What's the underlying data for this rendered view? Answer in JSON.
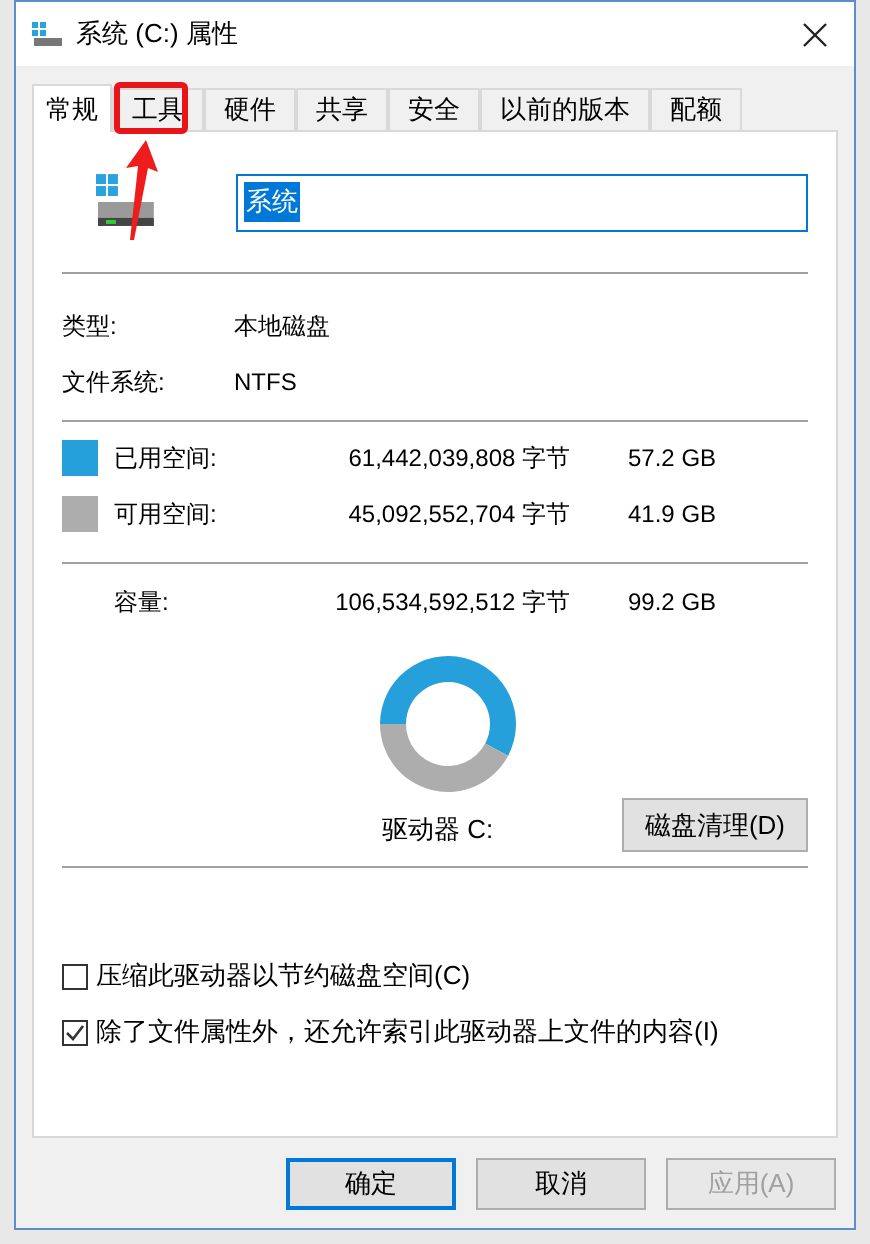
{
  "window": {
    "title": "系统 (C:) 属性"
  },
  "tabs": [
    {
      "label": "常规",
      "selected": true
    },
    {
      "label": "工具",
      "selected": false,
      "highlighted": true
    },
    {
      "label": "硬件",
      "selected": false
    },
    {
      "label": "共享",
      "selected": false
    },
    {
      "label": "安全",
      "selected": false
    },
    {
      "label": "以前的版本",
      "selected": false
    },
    {
      "label": "配额",
      "selected": false
    }
  ],
  "name_field": {
    "value": "系统"
  },
  "info": [
    {
      "label": "类型:",
      "value": "本地磁盘"
    },
    {
      "label": "文件系统:",
      "value": "NTFS"
    }
  ],
  "space": [
    {
      "label": "已用空间:",
      "bytes": "61,442,039,808 字节",
      "size": "57.2 GB",
      "color": "#26a0da"
    },
    {
      "label": "可用空间:",
      "bytes": "45,092,552,704 字节",
      "size": "41.9 GB",
      "color": "#adadad"
    }
  ],
  "capacity": {
    "label": "容量:",
    "bytes": "106,534,592,512 字节",
    "size": "99.2 GB"
  },
  "drive_label": "驱动器 C:",
  "cleanup_button": "磁盘清理(D)",
  "options": [
    {
      "label": "压缩此驱动器以节约磁盘空间(C)",
      "checked": false
    },
    {
      "label": "除了文件属性外，还允许索引此驱动器上文件的内容(I)",
      "checked": true
    }
  ],
  "buttons": [
    {
      "label": "确定",
      "default": true,
      "disabled": false
    },
    {
      "label": "取消",
      "default": false,
      "disabled": false
    },
    {
      "label": "应用(A)",
      "default": false,
      "disabled": true
    }
  ]
}
